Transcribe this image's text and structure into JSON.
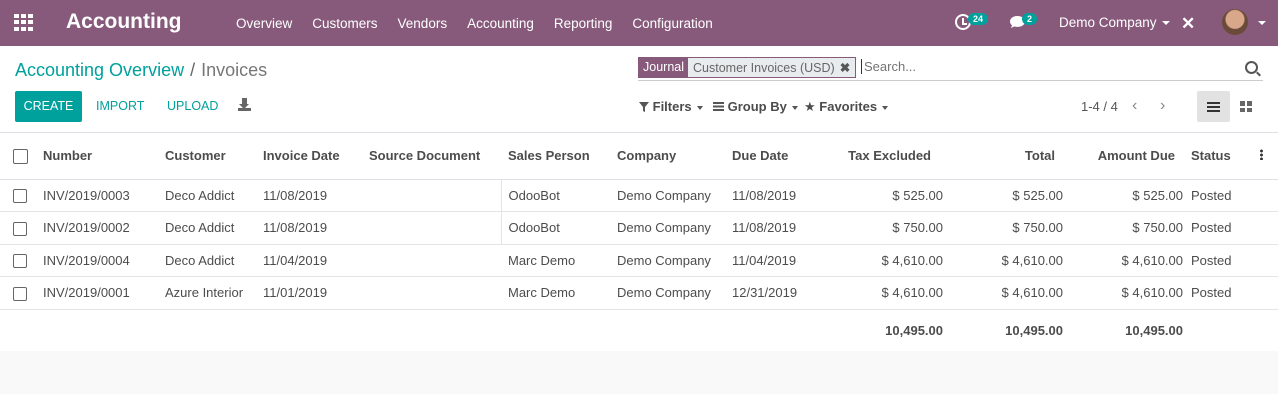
{
  "navbar": {
    "app_title": "Accounting",
    "menu": [
      "Overview",
      "Customers",
      "Vendors",
      "Accounting",
      "Reporting",
      "Configuration"
    ],
    "activity_count": "24",
    "message_count": "2",
    "company": "Demo Company"
  },
  "breadcrumb": {
    "parent": "Accounting Overview",
    "separator": "/",
    "current": "Invoices"
  },
  "search": {
    "facet_label": "Journal",
    "facet_value": "Customer Invoices (USD)",
    "placeholder": "Search..."
  },
  "buttons": {
    "create": "CREATE",
    "import": "IMPORT",
    "upload": "UPLOAD"
  },
  "filters": {
    "filters": "Filters",
    "group_by": "Group By",
    "favorites": "Favorites"
  },
  "pager": {
    "value": "1-4 / 4"
  },
  "table": {
    "headers": {
      "number": "Number",
      "customer": "Customer",
      "invoice_date": "Invoice Date",
      "source_document": "Source Document",
      "sales_person": "Sales Person",
      "company": "Company",
      "due_date": "Due Date",
      "tax_excluded": "Tax Excluded",
      "total": "Total",
      "amount_due": "Amount Due",
      "status": "Status"
    },
    "rows": [
      {
        "number": "INV/2019/0003",
        "customer": "Deco Addict",
        "invoice_date": "11/08/2019",
        "source_document": "",
        "sales_person": "OdooBot",
        "company": "Demo Company",
        "due_date": "11/08/2019",
        "tax_excluded": "$ 525.00",
        "total": "$ 525.00",
        "amount_due": "$ 525.00",
        "status": "Posted"
      },
      {
        "number": "INV/2019/0002",
        "customer": "Deco Addict",
        "invoice_date": "11/08/2019",
        "source_document": "",
        "sales_person": "OdooBot",
        "company": "Demo Company",
        "due_date": "11/08/2019",
        "tax_excluded": "$ 750.00",
        "total": "$ 750.00",
        "amount_due": "$ 750.00",
        "status": "Posted"
      },
      {
        "number": "INV/2019/0004",
        "customer": "Deco Addict",
        "invoice_date": "11/04/2019",
        "source_document": "",
        "sales_person": "Marc Demo",
        "company": "Demo Company",
        "due_date": "11/04/2019",
        "tax_excluded": "$ 4,610.00",
        "total": "$ 4,610.00",
        "amount_due": "$ 4,610.00",
        "status": "Posted"
      },
      {
        "number": "INV/2019/0001",
        "customer": "Azure Interior",
        "invoice_date": "11/01/2019",
        "source_document": "",
        "sales_person": "Marc Demo",
        "company": "Demo Company",
        "due_date": "12/31/2019",
        "tax_excluded": "$ 4,610.00",
        "total": "$ 4,610.00",
        "amount_due": "$ 4,610.00",
        "status": "Posted"
      }
    ],
    "totals": {
      "tax_excluded": "10,495.00",
      "total": "10,495.00",
      "amount_due": "10,495.00"
    }
  },
  "colors": {
    "brand": "#875a7b",
    "accent": "#00a09d"
  }
}
